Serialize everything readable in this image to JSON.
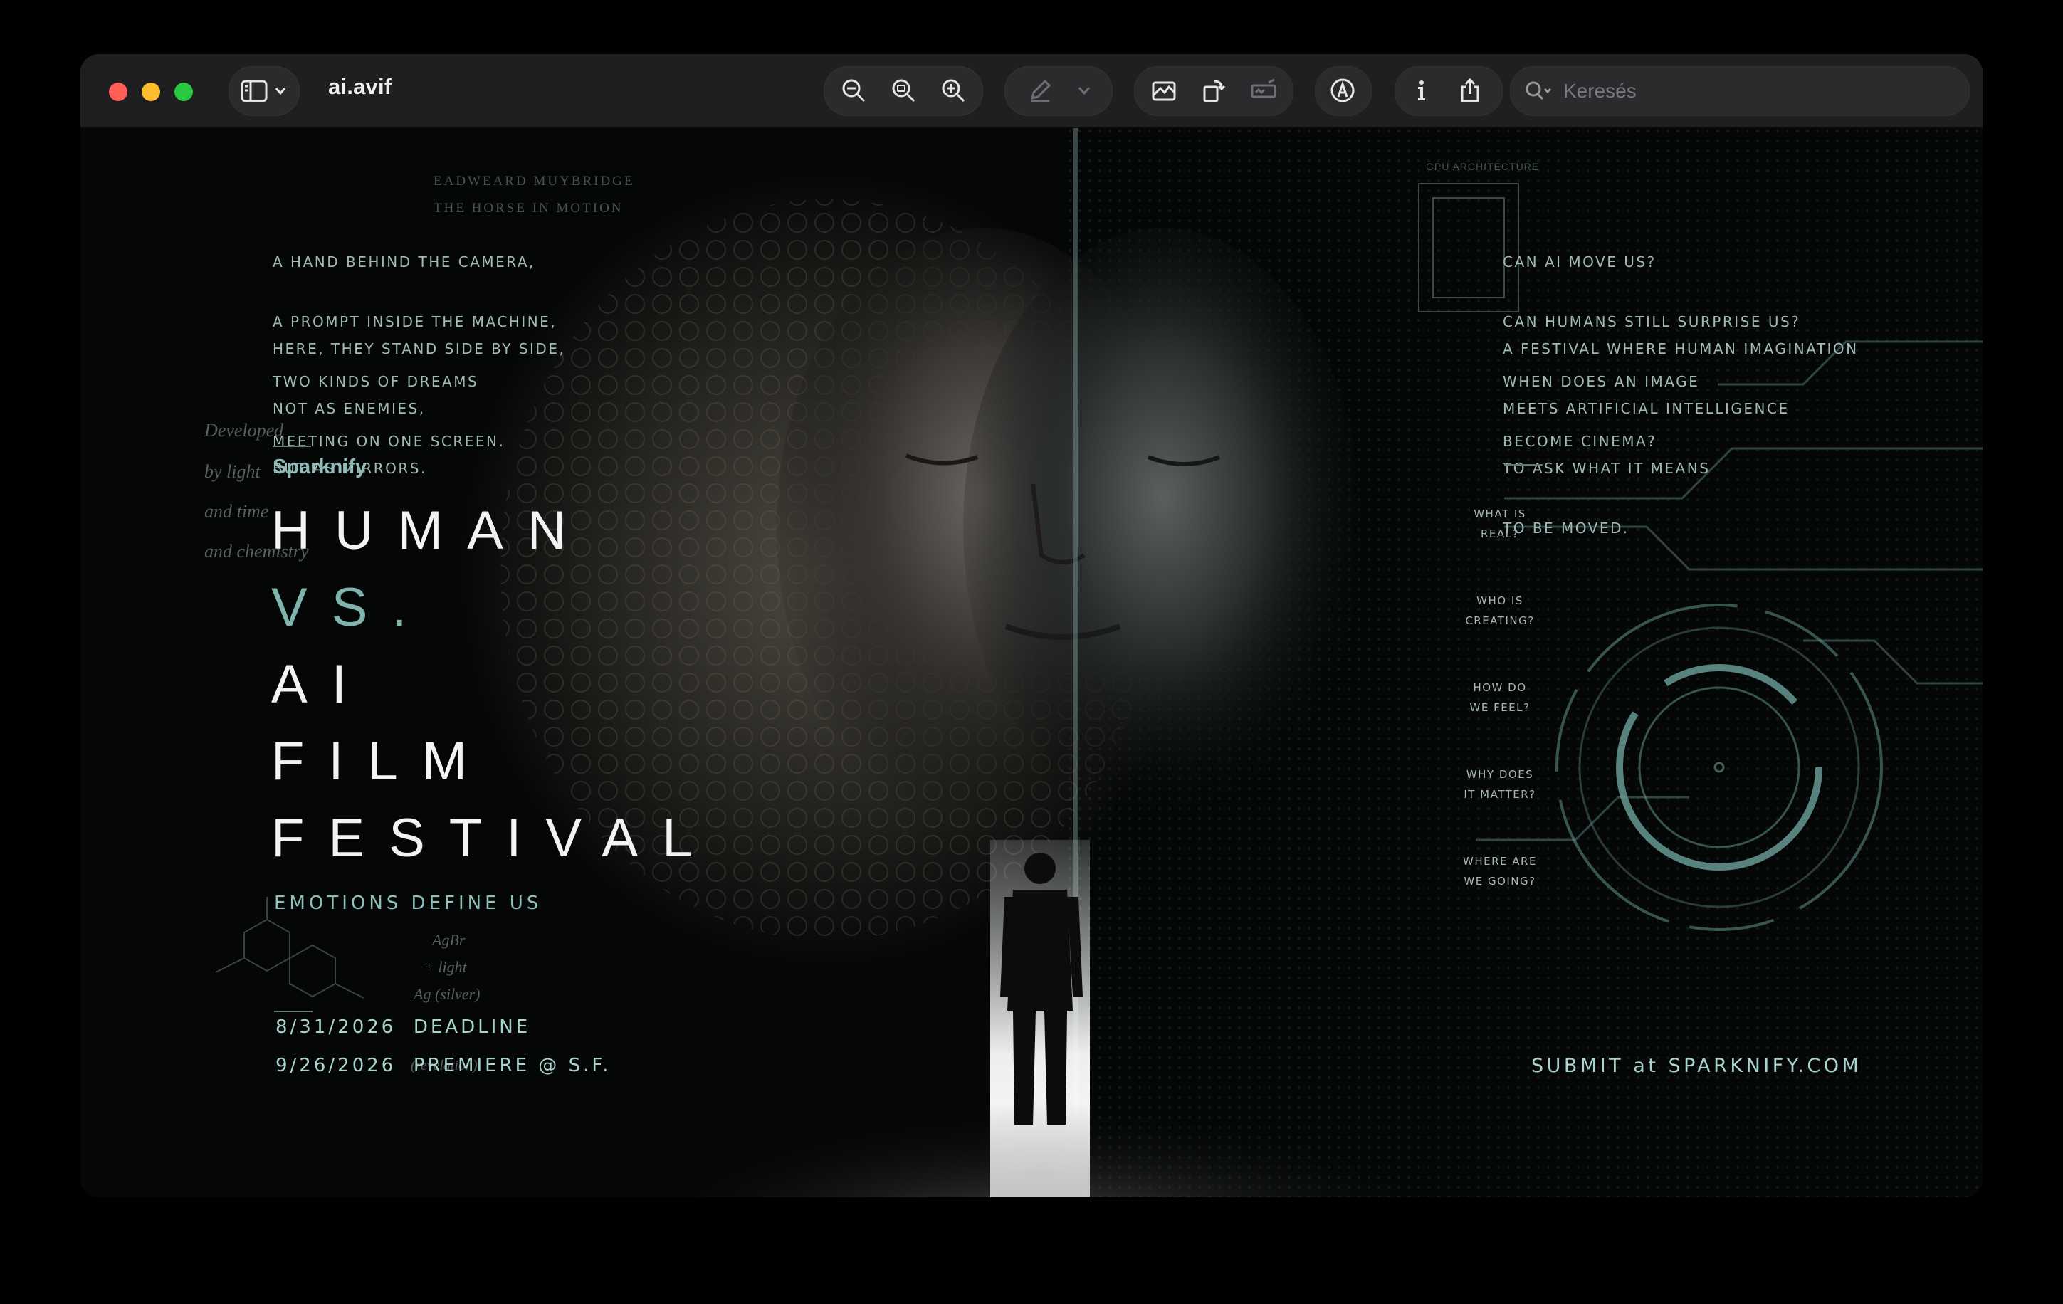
{
  "window": {
    "title": "ai.avif",
    "search_placeholder": "Keresés"
  },
  "toolbar": {
    "icons": [
      "sidebar-toggle-icon",
      "zoom-out-icon",
      "zoom-actual-icon",
      "zoom-in-icon",
      "markup-pen-icon",
      "chevron-down-icon",
      "crop-icon",
      "rotate-icon",
      "signature-icon",
      "markup-circle-icon",
      "info-icon",
      "share-icon",
      "search-icon"
    ]
  },
  "poster": {
    "intro_lines": [
      "A HAND BEHIND THE CAMERA,",
      "A PROMPT INSIDE THE MACHINE,",
      "TWO KINDS OF DREAMS",
      "MEETING ON ONE SCREEN."
    ],
    "intro_lines_2": [
      "HERE, THEY STAND SIDE BY SIDE,",
      "NOT AS ENEMIES,",
      "BUT AS MIRRORS."
    ],
    "brand": "Sparknify",
    "title_lines": [
      "HUMAN",
      "VS.",
      "AI",
      "FILM",
      "FESTIVAL"
    ],
    "tagline": "EMOTIONS DEFINE US",
    "deadline": "8/31/2026  DEADLINE",
    "premiere": "9/26/2026  PREMIERE @ S.F.",
    "questions_top": [
      "CAN AI MOVE US?",
      "CAN HUMANS STILL SURPRISE US?",
      "WHEN DOES AN IMAGE",
      "BECOME CINEMA?"
    ],
    "festival_blurb": [
      "A FESTIVAL WHERE HUMAN IMAGINATION",
      "MEETS ARTIFICIAL INTELLIGENCE",
      "TO ASK WHAT IT MEANS",
      "TO BE MOVED."
    ],
    "side_questions": [
      "WHAT IS\nREAL?",
      "WHO IS\nCREATING?",
      "HOW DO\nWE FEEL?",
      "WHY DOES\nIT MATTER?",
      "WHERE ARE\nWE GOING?"
    ],
    "submit": "SUBMIT at SPARKNIFY.COM",
    "muybridge_1": "EADWEARD MUYBRIDGE",
    "muybridge_2": "THE HORSE IN MOTION",
    "gpu_label": "GPU ARCHITECTURE",
    "script_1": "Developed",
    "script_2": "by light",
    "script_3": "and time",
    "script_4": "and chemistry",
    "chem_1": "AgBr",
    "chem_2": "+ light",
    "chem_3": "Ag (silver)",
    "chem_4": "(revelation)"
  },
  "colors": {
    "accent_teal": "#7fb3ad",
    "window_bg": "#1f1f21"
  }
}
